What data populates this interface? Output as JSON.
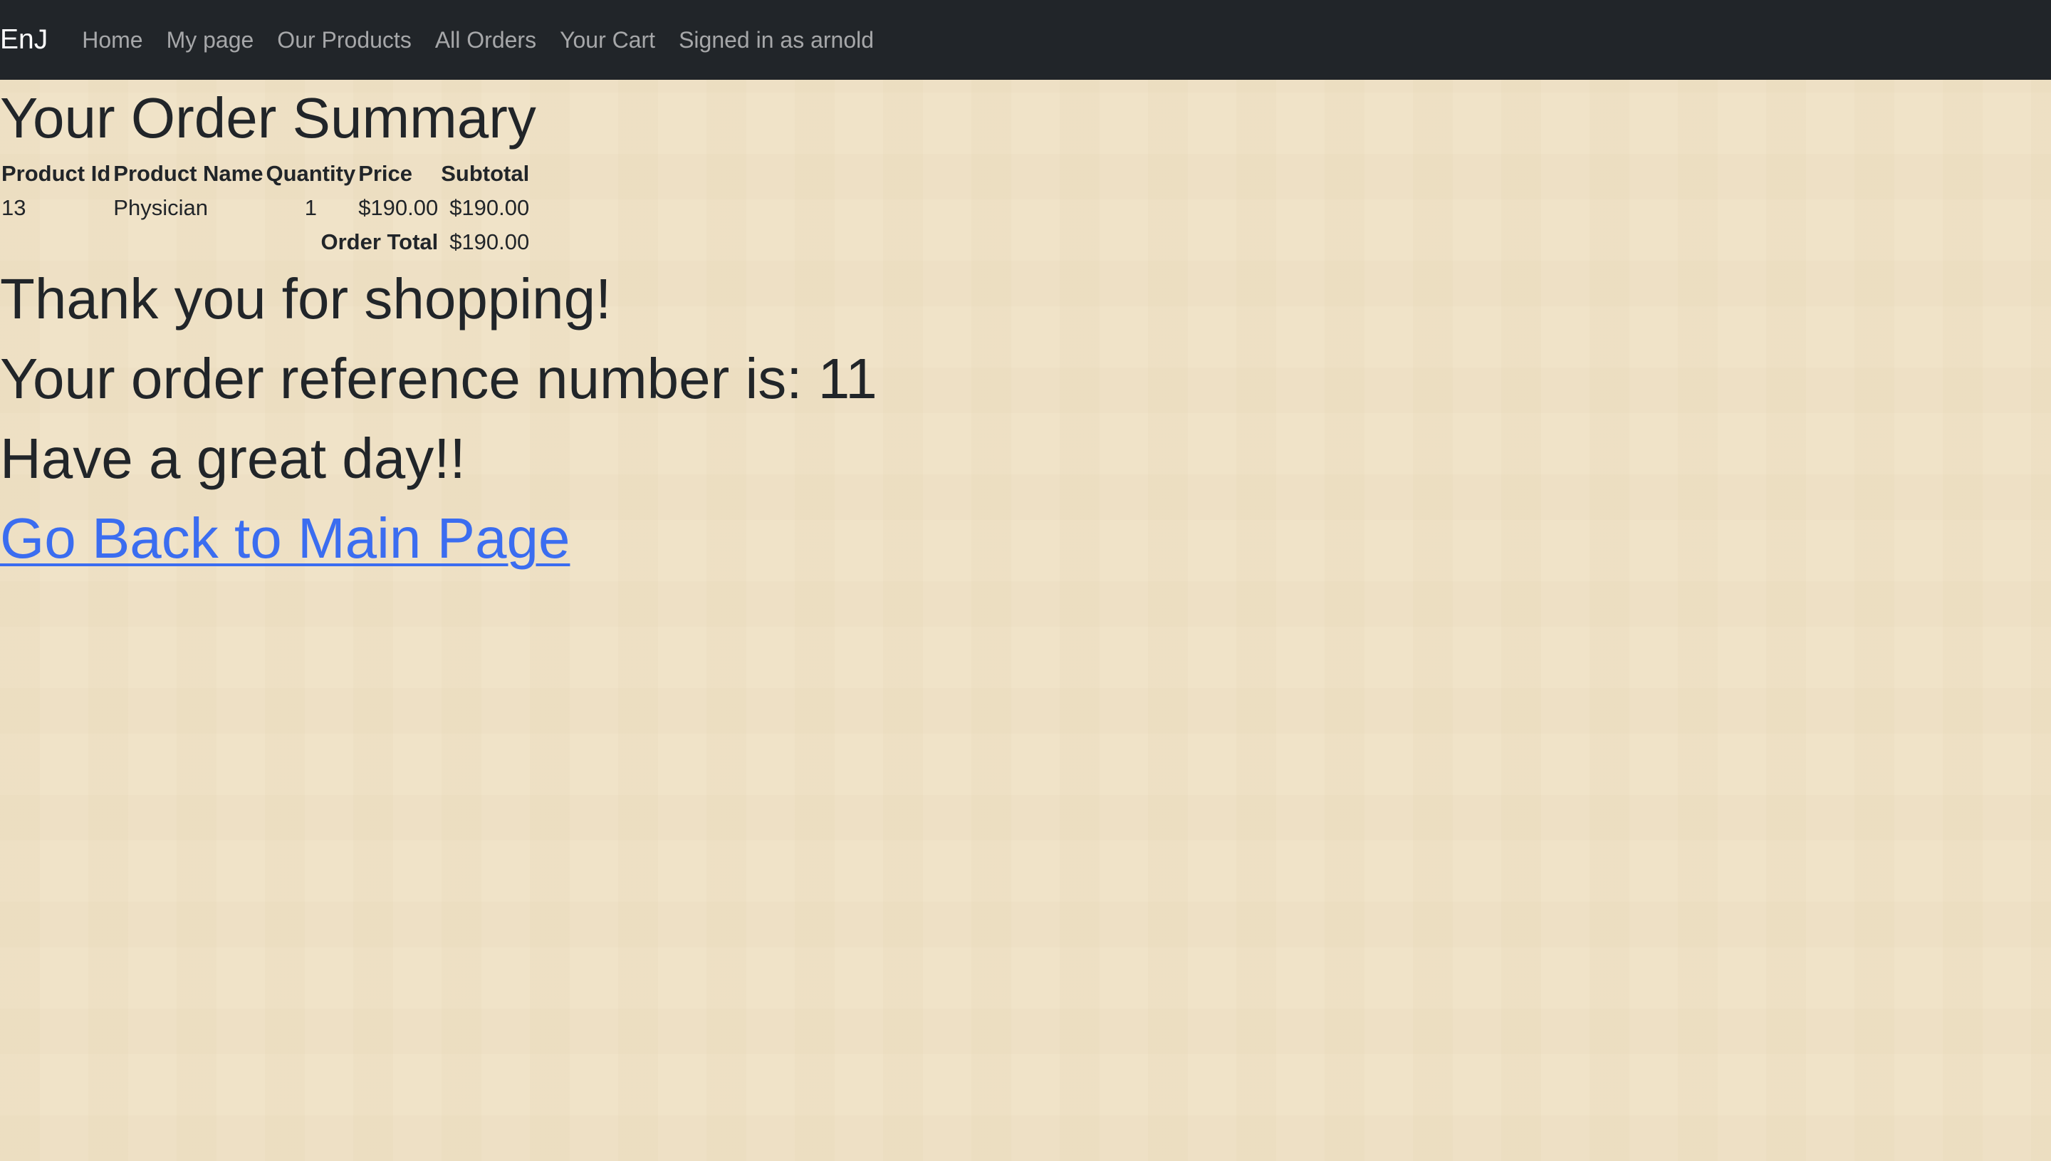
{
  "navbar": {
    "brand": "EnJ",
    "links": [
      "Home",
      "My page",
      "Our Products",
      "All Orders",
      "Your Cart",
      "Signed in as arnold"
    ]
  },
  "page": {
    "title": "Your Order Summary",
    "table": {
      "headers": [
        "Product Id",
        "Product Name",
        "Quantity",
        "Price",
        "Subtotal"
      ],
      "rows": [
        [
          "13",
          "Physician",
          "1",
          "$190.00",
          "$190.00"
        ]
      ],
      "total_label": "Order Total",
      "total_value": "$190.00"
    },
    "messages": [
      "Thank you for shopping!",
      "Your order reference number is: 11",
      "Have a great day!!"
    ],
    "back_link": "Go Back to Main Page"
  },
  "colors": {
    "navbar_bg": "#212529",
    "page_bg": "#f0e3c8",
    "link": "#3b6df0",
    "text": "#212529"
  }
}
